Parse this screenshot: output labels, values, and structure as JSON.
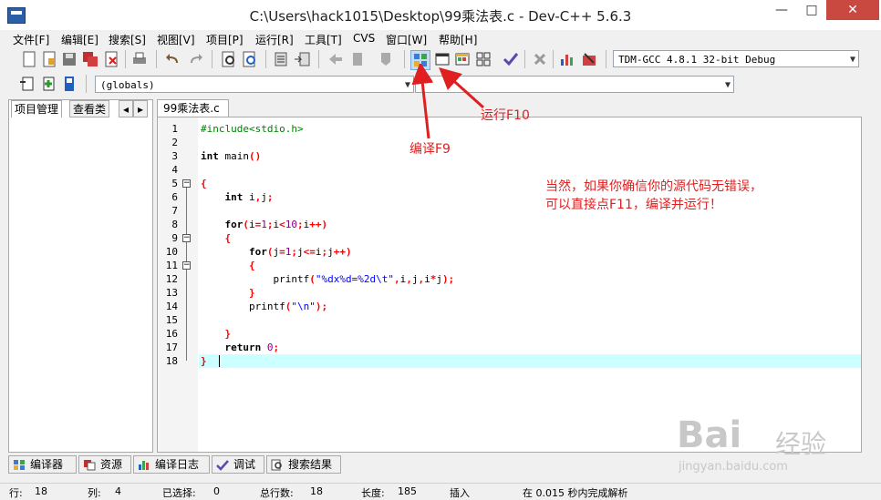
{
  "window": {
    "title": "C:\\Users\\hack1015\\Desktop\\99乘法表.c - Dev-C++ 5.6.3",
    "minimize_glyph": "—",
    "maximize_glyph": "□",
    "close_glyph": "✕"
  },
  "menu": [
    "文件[F]",
    "编辑[E]",
    "搜索[S]",
    "视图[V]",
    "项目[P]",
    "运行[R]",
    "工具[T]",
    "CVS",
    "窗口[W]",
    "帮助[H]"
  ],
  "toolbar": {
    "compiler_select": "TDM-GCC 4.8.1 32-bit Debug",
    "scope_select": "(globals)",
    "function_select": ""
  },
  "left_panel": {
    "tabs": [
      "项目管理",
      "查看类"
    ],
    "prev_glyph": "◂",
    "next_glyph": "▸"
  },
  "editor": {
    "file_tab": "99乘法表.c",
    "line_numbers": [
      "1",
      "2",
      "3",
      "4",
      "5",
      "6",
      "7",
      "8",
      "9",
      "10",
      "11",
      "12",
      "13",
      "14",
      "15",
      "16",
      "17",
      "18"
    ],
    "current_line": 18
  },
  "annotations": {
    "compile": "编译F9",
    "run": "运行F10",
    "note_line1": "当然，如果你确信你的源代码无错误，",
    "note_line2": "可以直接点F11，编译并运行！"
  },
  "bottom_tabs": [
    "编译器",
    "资源",
    "编译日志",
    "调试",
    "搜索结果"
  ],
  "status": {
    "row_label": "行:",
    "row": "18",
    "col_label": "列:",
    "col": "4",
    "sel_label": "已选择:",
    "sel": "0",
    "total_label": "总行数:",
    "total": "18",
    "len_label": "长度:",
    "len": "185",
    "mode": "插入",
    "parse": "在 0.015 秒内完成解析"
  },
  "watermark": {
    "brand": "Bai",
    "brand2": "经验",
    "url": "jingyan.baidu.com"
  },
  "colors": {
    "annotation": "#e02020",
    "current_line": "#ccffff",
    "close_button": "#c9483f"
  }
}
